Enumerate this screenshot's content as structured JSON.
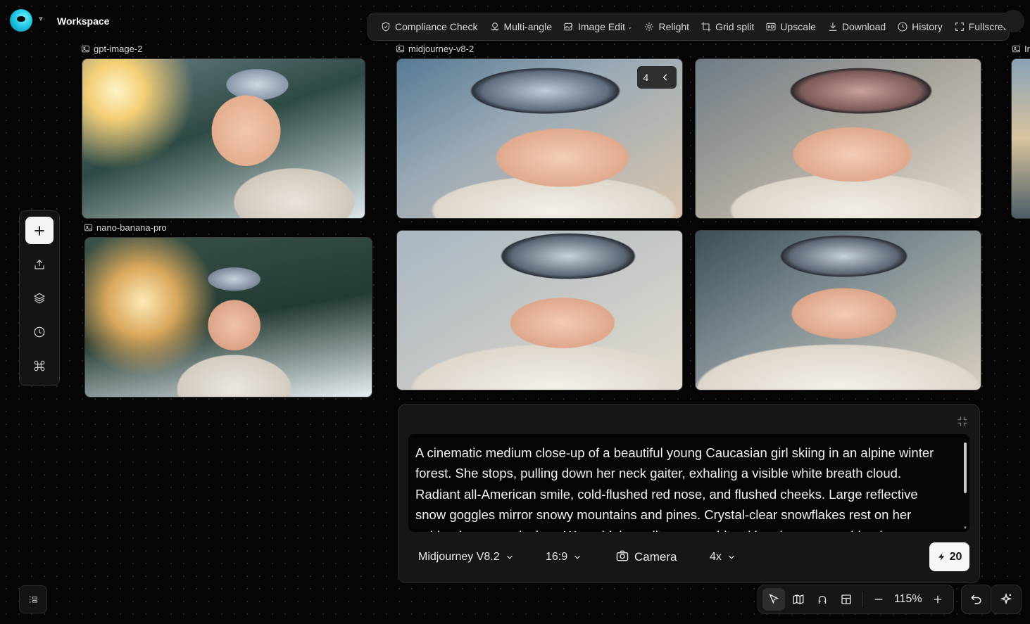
{
  "header": {
    "workspace_title": "Workspace"
  },
  "toolbar": {
    "items": [
      {
        "label": "Compliance Check",
        "icon": "shield-icon"
      },
      {
        "label": "Multi-angle",
        "icon": "orbit-icon"
      },
      {
        "label": "Image Edit",
        "icon": "edit-image-icon"
      },
      {
        "label": "Relight",
        "icon": "sparkle-light-icon"
      },
      {
        "label": "Grid split",
        "icon": "crop-icon"
      },
      {
        "label": "Upscale",
        "icon": "hd-icon"
      },
      {
        "label": "Download",
        "icon": "download-icon"
      },
      {
        "label": "History",
        "icon": "clock-icon"
      },
      {
        "label": "Fullscreen",
        "icon": "fullscreen-icon"
      }
    ]
  },
  "canvas": {
    "groups": [
      {
        "label": "gpt-image-2"
      },
      {
        "label": "nano-banana-pro"
      },
      {
        "label": "midjourney-v8-2"
      },
      {
        "label": "Ir"
      }
    ],
    "image_counter": "4"
  },
  "tools": {
    "icons": [
      "plus-icon",
      "upload-icon",
      "layers-icon",
      "clock-icon",
      "command-icon"
    ]
  },
  "prompt": {
    "text": "A cinematic medium close-up of a beautiful young Caucasian girl skiing in an alpine winter forest. She stops, pulling down her neck gaiter, exhaling a visible white breath cloud. Radiant all-American smile, cold-flushed red nose, and flushed cheeks. Large reflective snow goggles mirror snowy mountains and pines. Crystal-clear snowflakes rest on her golden-brown eyelashes. Warm high-quality warm white ski parka, warm golden-hour backlight.",
    "model": "Midjourney V8.2",
    "aspect_ratio": "16:9",
    "camera_label": "Camera",
    "count": "4x",
    "credits": "20"
  },
  "view_bar": {
    "zoom": "115%"
  }
}
